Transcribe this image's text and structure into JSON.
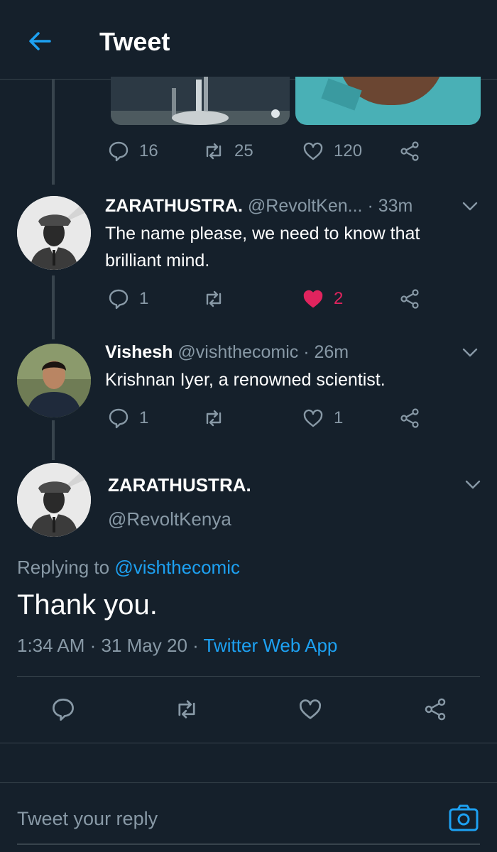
{
  "header": {
    "title": "Tweet"
  },
  "parent_tweet": {
    "reply_count": "16",
    "retweet_count": "25",
    "like_count": "120"
  },
  "reply1": {
    "display_name": "ZARATHUSTRA.",
    "handle": "@RevoltKen...",
    "time": "· 33m",
    "text": "The name please, we need to know that brilliant mind.",
    "reply_count": "1",
    "like_count": "2"
  },
  "reply2": {
    "display_name": "Vishesh",
    "handle": "@vishthecomic",
    "time": "· 26m",
    "text": "Krishnan Iyer, a renowned scientist.",
    "reply_count": "1",
    "like_count": "1"
  },
  "main_tweet": {
    "display_name": "ZARATHUSTRA.",
    "handle": "@RevoltKenya",
    "replying_to_label": "Replying to",
    "replying_to_handle": "@vishthecomic",
    "text": "Thank you.",
    "timestamp": "1:34 AM · 31 May 20 · ",
    "source": "Twitter Web App"
  },
  "reply_bar": {
    "placeholder": "Tweet your reply"
  },
  "colors": {
    "background": "#15202b",
    "accent": "#1da1f2",
    "like": "#e0245e",
    "muted": "#8899a6"
  }
}
